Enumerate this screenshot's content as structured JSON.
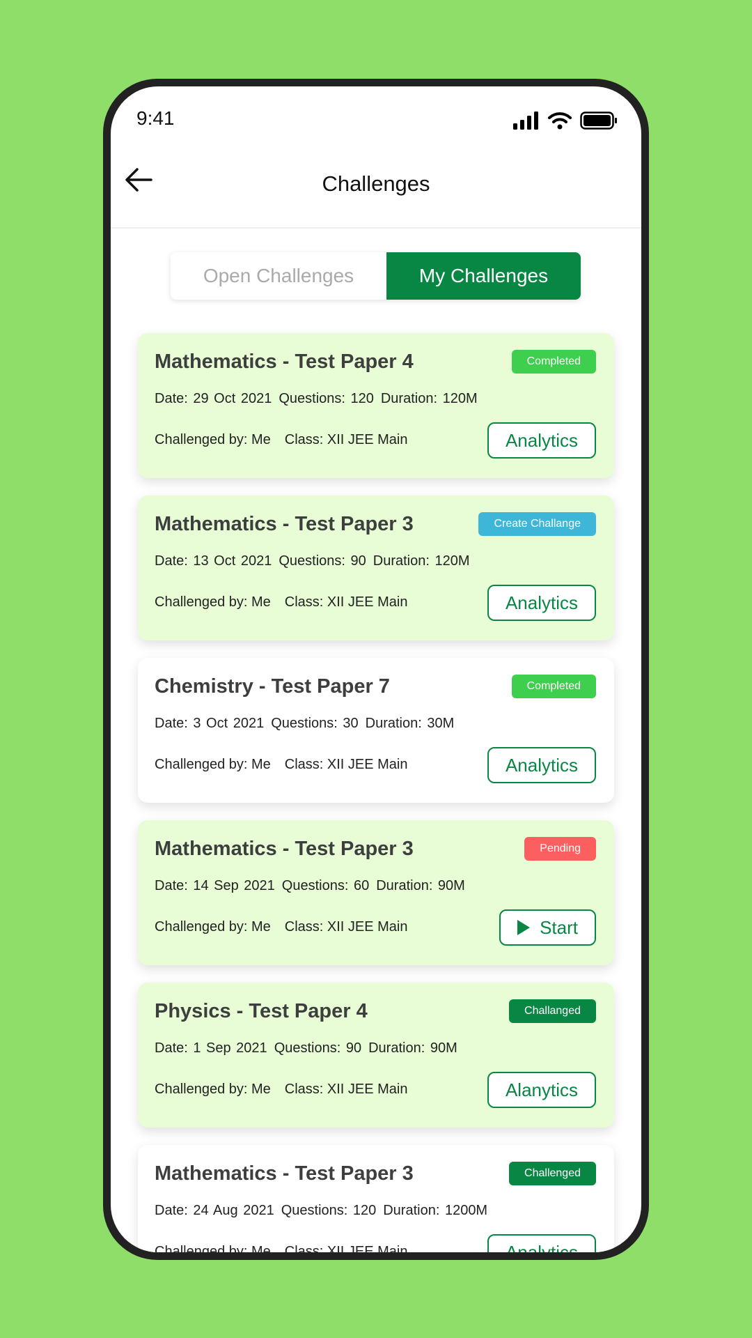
{
  "status": {
    "time": "9:41"
  },
  "header": {
    "title": "Challenges"
  },
  "tabs": [
    {
      "label": "Open Challenges",
      "active": false
    },
    {
      "label": "My Challenges",
      "active": true
    }
  ],
  "colors": {
    "primary": "#078743",
    "completed": "#3ecf4f",
    "create": "#3eb6d8",
    "pending": "#fb5f5f",
    "challenged": "#078743",
    "card_highlight": "#e8fcd6"
  },
  "cards": [
    {
      "title": "Mathematics - Test Paper 4",
      "badge": "Completed",
      "badge_color": "#3ecf4f",
      "bg": "g",
      "date": "Date: 29 Oct 2021",
      "questions": "Questions: 120",
      "duration": "Duration: 120M",
      "by": "Challenged by: Me",
      "class": "Class: XII JEE Main",
      "action": "Analytics",
      "action_icon": ""
    },
    {
      "title": "Mathematics - Test Paper 3",
      "badge": "Create Challange",
      "badge_color": "#3eb6d8",
      "bg": "g",
      "date": "Date: 13 Oct 2021",
      "questions": "Questions: 90",
      "duration": "Duration: 120M",
      "by": "Challenged by: Me",
      "class": "Class: XII JEE Main",
      "action": "Analytics",
      "action_icon": ""
    },
    {
      "title": "Chemistry - Test Paper 7",
      "badge": "Completed",
      "badge_color": "#3ecf4f",
      "bg": "w",
      "date": "Date: 3 Oct 2021",
      "questions": "Questions: 30",
      "duration": "Duration: 30M",
      "by": "Challenged by: Me",
      "class": "Class: XII JEE Main",
      "action": "Analytics",
      "action_icon": ""
    },
    {
      "title": "Mathematics - Test Paper 3",
      "badge": "Pending",
      "badge_color": "#fb5f5f",
      "bg": "g",
      "date": "Date: 14 Sep 2021",
      "questions": "Questions: 60",
      "duration": "Duration: 90M",
      "by": "Challenged by: Me",
      "class": "Class: XII JEE Main",
      "action": "Start",
      "action_icon": "play-icon"
    },
    {
      "title": "Physics - Test Paper 4",
      "badge": "Challanged",
      "badge_color": "#078743",
      "bg": "g",
      "date": "Date: 1 Sep 2021",
      "questions": "Questions: 90",
      "duration": "Duration: 90M",
      "by": "Challenged by: Me",
      "class": "Class: XII JEE Main",
      "action": "Alanytics",
      "action_icon": ""
    },
    {
      "title": "Mathematics - Test Paper 3",
      "badge": "Challenged",
      "badge_color": "#078743",
      "bg": "w",
      "date": "Date: 24 Aug 2021",
      "questions": "Questions: 120",
      "duration": "Duration: 1200M",
      "by": "Challenged by: Me",
      "class": "Class: XII JEE Main",
      "action": "Analytics",
      "action_icon": ""
    }
  ]
}
